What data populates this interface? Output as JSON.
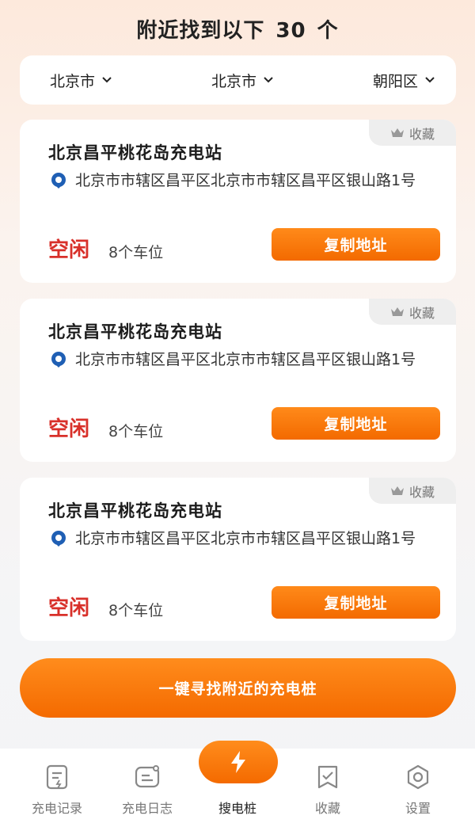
{
  "header": {
    "prefix": "附近找到以下",
    "count": "30",
    "suffix": "个"
  },
  "regions": [
    {
      "label": "北京市"
    },
    {
      "label": "北京市"
    },
    {
      "label": "朝阳区"
    }
  ],
  "stations": [
    {
      "favorite_label": "收藏",
      "name": "北京昌平桃花岛充电站",
      "address": "北京市市辖区昌平区北京市市辖区昌平区银山路1号",
      "status": "空闲",
      "spaces": "8个车位",
      "copy_label": "复制地址"
    },
    {
      "favorite_label": "收藏",
      "name": "北京昌平桃花岛充电站",
      "address": "北京市市辖区昌平区北京市市辖区昌平区银山路1号",
      "status": "空闲",
      "spaces": "8个车位",
      "copy_label": "复制地址"
    },
    {
      "favorite_label": "收藏",
      "name": "北京昌平桃花岛充电站",
      "address": "北京市市辖区昌平区北京市市辖区昌平区银山路1号",
      "status": "空闲",
      "spaces": "8个车位",
      "copy_label": "复制地址"
    }
  ],
  "find_button": "一键寻找附近的充电桩",
  "tabbar": {
    "items": [
      {
        "label": "充电记录",
        "icon": "charge-record-icon"
      },
      {
        "label": "充电日志",
        "icon": "charge-log-icon"
      },
      {
        "label": "搜电桩",
        "icon": "lightning-icon",
        "active": true
      },
      {
        "label": "收藏",
        "icon": "favorite-icon"
      },
      {
        "label": "设置",
        "icon": "settings-icon"
      }
    ]
  },
  "colors": {
    "accent": "#f57a0c",
    "status_idle": "#d8302a"
  }
}
